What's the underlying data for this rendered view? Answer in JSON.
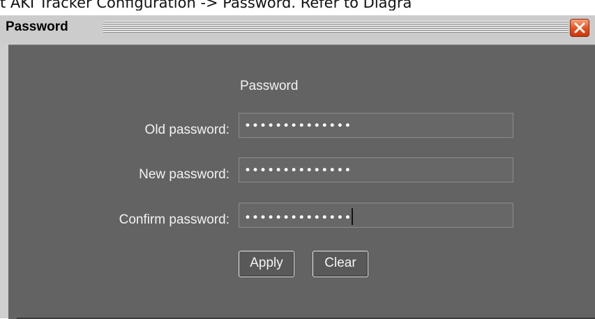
{
  "caption": "t AKI Tracker Configuration -> Password. Refer to Diagra",
  "window": {
    "title": "Password",
    "close_icon": "close-icon"
  },
  "form": {
    "heading": "Password",
    "old_label": "Old password:",
    "old_value": "••••••••••••••",
    "new_label": "New password:",
    "new_value": "••••••••••••••",
    "confirm_label": "Confirm password:",
    "confirm_value": "••••••••••••••"
  },
  "buttons": {
    "apply": "Apply",
    "clear": "Clear"
  },
  "colors": {
    "panel": "#636363",
    "titlebar": "#cccccc",
    "close": "#e5501f"
  }
}
